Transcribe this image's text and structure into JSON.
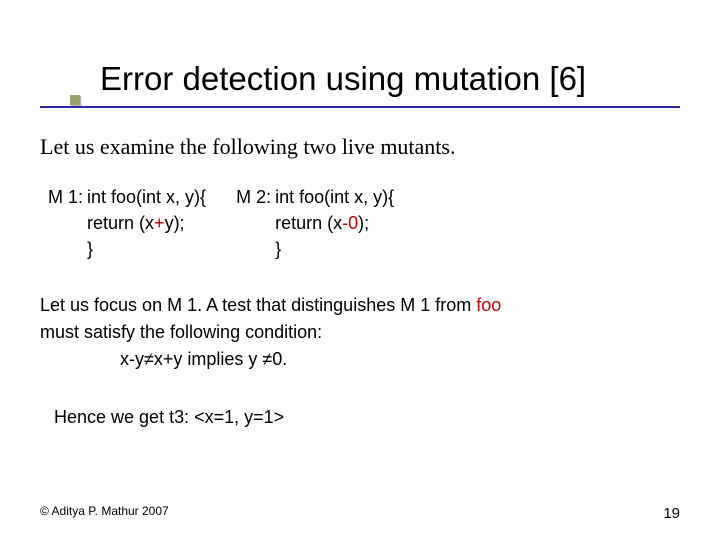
{
  "title": "Error detection using mutation [6]",
  "intro": "Let us examine the following two live mutants.",
  "mutants": {
    "m1": {
      "label": "M 1:",
      "sig_pre": "int foo(int x, y){",
      "ret_pre": "return (x",
      "op": "+",
      "ret_post": "y);",
      "close": "}"
    },
    "m2": {
      "label": "M 2:",
      "sig_pre": "int foo(int x, y){",
      "ret_pre": "return (x",
      "op": "-0",
      "ret_post": ");",
      "close": "}"
    }
  },
  "explain": {
    "line1a": "Let us focus on M 1. A test that distinguishes M 1 from ",
    "foo": "foo",
    "line2": "must satisfy the following condition:",
    "cond": "x-y≠x+y implies y ≠0."
  },
  "result": "Hence we get t3: <x=1, y=1>",
  "footer": {
    "copyright": "© Aditya P. Mathur 2007",
    "page": "19"
  }
}
